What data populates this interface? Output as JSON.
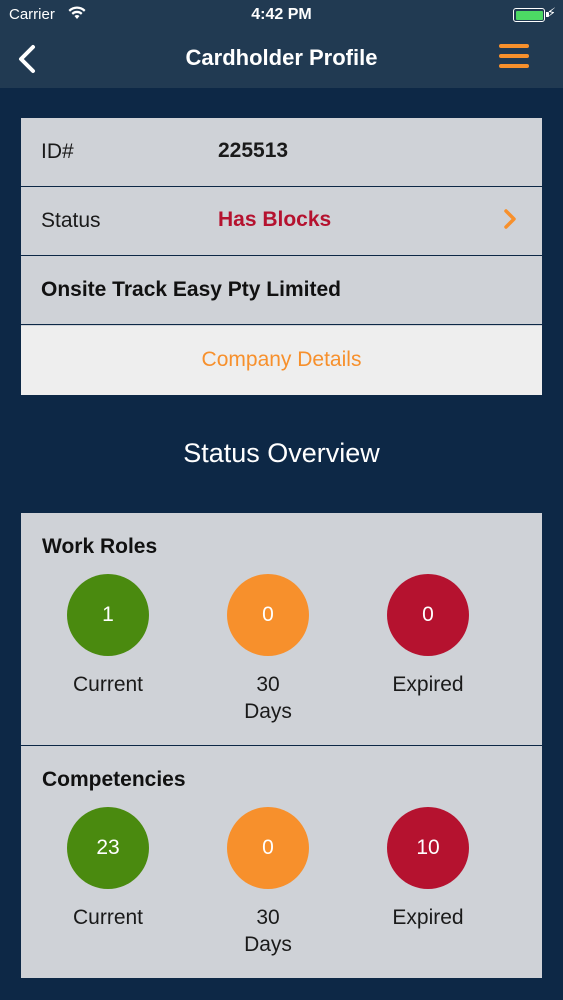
{
  "status_bar": {
    "carrier": "Carrier",
    "time": "4:42 PM",
    "battery_level": 1.0,
    "battery_color": "#4cd964"
  },
  "nav": {
    "title": "Cardholder Profile",
    "back_icon": "chevron-left-icon",
    "menu_icon": "hamburger-menu-icon",
    "menu_color": "#f7902c"
  },
  "profile": {
    "id_label": "ID#",
    "id_value": "225513",
    "status_label": "Status",
    "status_value": "Has Blocks",
    "status_color": "#b5122f",
    "company_name": "Onsite Track Easy Pty Limited",
    "company_details_link": "Company Details"
  },
  "overview": {
    "title": "Status Overview",
    "work_roles": {
      "title": "Work Roles",
      "current_count": "1",
      "current_label": "Current",
      "days30_count": "0",
      "days30_label_line1": "30",
      "days30_label_line2": "Days",
      "expired_count": "0",
      "expired_label": "Expired"
    },
    "competencies": {
      "title": "Competencies",
      "current_count": "23",
      "current_label": "Current",
      "days30_count": "0",
      "days30_label_line1": "30",
      "days30_label_line2": "Days",
      "expired_count": "10",
      "expired_label": "Expired"
    },
    "colors": {
      "current": "#4a8a0f",
      "days30": "#f7902c",
      "expired": "#b5122f"
    }
  }
}
